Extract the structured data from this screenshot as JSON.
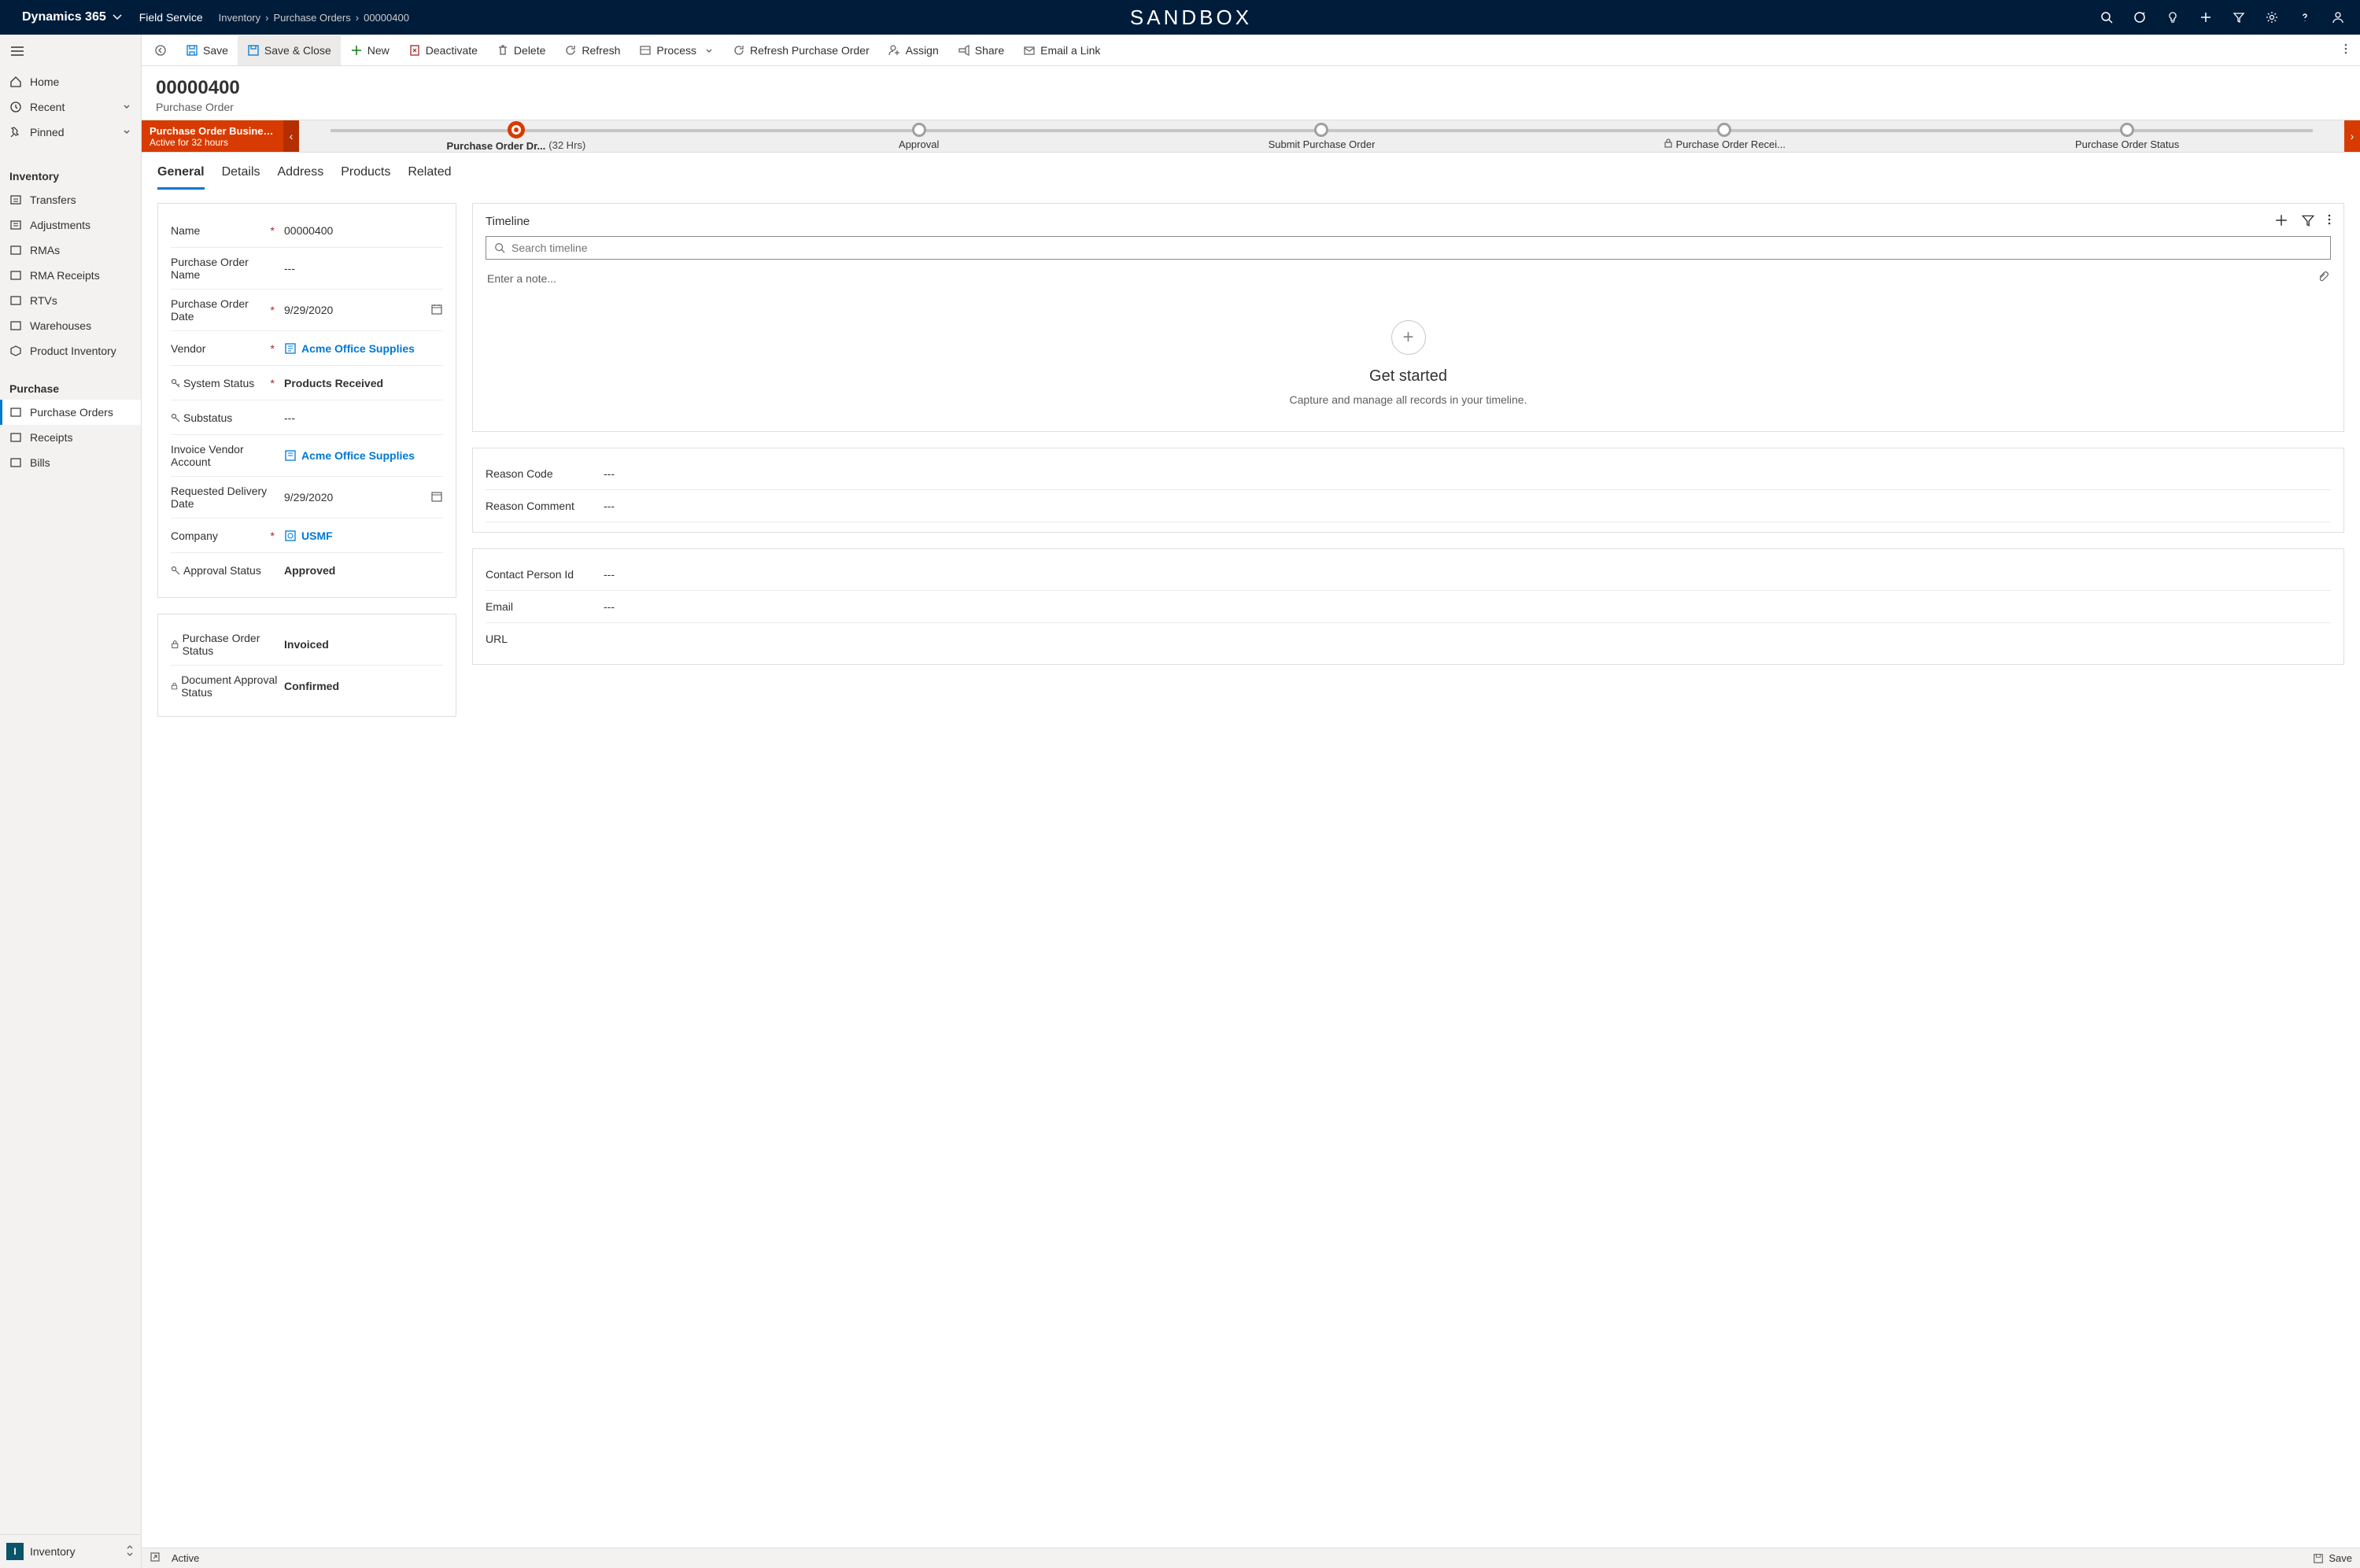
{
  "topbar": {
    "brand": "Dynamics 365",
    "app": "Field Service",
    "breadcrumb": [
      "Inventory",
      "Purchase Orders",
      "00000400"
    ],
    "center": "SANDBOX"
  },
  "sidebar": {
    "home": "Home",
    "recent": "Recent",
    "pinned": "Pinned",
    "sec_inventory": "Inventory",
    "transfers": "Transfers",
    "adjustments": "Adjustments",
    "rmas": "RMAs",
    "rma_receipts": "RMA Receipts",
    "rtvs": "RTVs",
    "warehouses": "Warehouses",
    "product_inventory": "Product Inventory",
    "sec_purchase": "Purchase",
    "purchase_orders": "Purchase Orders",
    "receipts": "Receipts",
    "bills": "Bills",
    "bottom_label": "Inventory",
    "bottom_letter": "I"
  },
  "cmdbar": {
    "save": "Save",
    "save_close": "Save & Close",
    "new": "New",
    "deactivate": "Deactivate",
    "delete": "Delete",
    "refresh": "Refresh",
    "process": "Process",
    "refresh_po": "Refresh Purchase Order",
    "assign": "Assign",
    "share": "Share",
    "email": "Email a Link"
  },
  "header": {
    "title": "00000400",
    "subtitle": "Purchase Order"
  },
  "bpf": {
    "name": "Purchase Order Business ...",
    "duration": "Active for 32 hours",
    "stage1": "Purchase Order Dr...",
    "stage1_time": "(32 Hrs)",
    "stage2": "Approval",
    "stage3": "Submit Purchase Order",
    "stage4": "Purchase Order Recei...",
    "stage5": "Purchase Order Status"
  },
  "tabs": {
    "general": "General",
    "details": "Details",
    "address": "Address",
    "products": "Products",
    "related": "Related"
  },
  "fields": {
    "name_lbl": "Name",
    "name_val": "00000400",
    "po_name_lbl": "Purchase Order Name",
    "po_name_val": "---",
    "po_date_lbl": "Purchase Order Date",
    "po_date_val": "9/29/2020",
    "vendor_lbl": "Vendor",
    "vendor_val": "Acme Office Supplies",
    "sys_status_lbl": "System Status",
    "sys_status_val": "Products Received",
    "substatus_lbl": "Substatus",
    "substatus_val": "---",
    "inv_vendor_lbl": "Invoice Vendor Account",
    "inv_vendor_val": "Acme Office Supplies",
    "req_del_lbl": "Requested Delivery Date",
    "req_del_val": "9/29/2020",
    "company_lbl": "Company",
    "company_val": "USMF",
    "appr_status_lbl": "Approval Status",
    "appr_status_val": "Approved",
    "po_status_lbl": "Purchase Order Status",
    "po_status_val": "Invoiced",
    "doc_appr_lbl": "Document Approval Status",
    "doc_appr_val": "Confirmed",
    "reason_code_lbl": "Reason Code",
    "reason_code_val": "---",
    "reason_comment_lbl": "Reason Comment",
    "reason_comment_val": "---",
    "contact_lbl": "Contact Person Id",
    "contact_val": "---",
    "email_lbl": "Email",
    "email_val": "---",
    "url_lbl": "URL"
  },
  "timeline": {
    "title": "Timeline",
    "search_ph": "Search timeline",
    "note_ph": "Enter a note...",
    "get_started": "Get started",
    "desc": "Capture and manage all records in your timeline."
  },
  "statusbar": {
    "status": "Active",
    "save": "Save"
  }
}
